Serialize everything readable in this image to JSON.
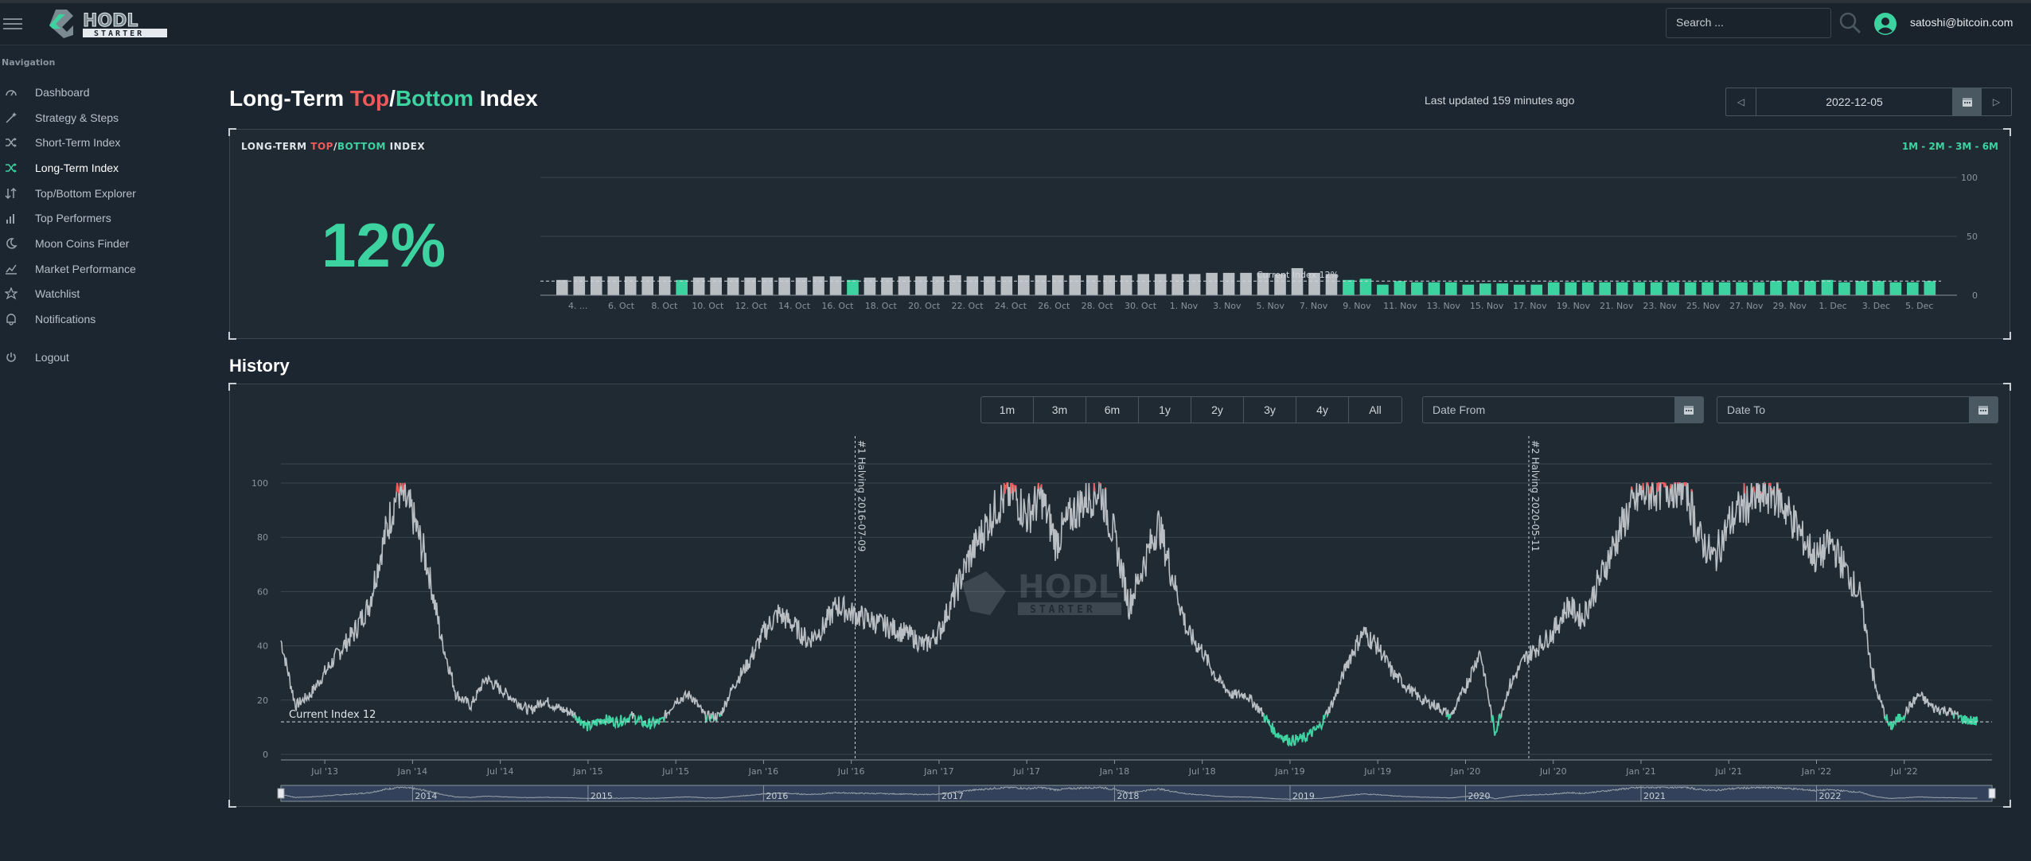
{
  "header": {
    "search_placeholder": "Search ...",
    "user_email": "satoshi@bitcoin.com"
  },
  "sidebar": {
    "title": "Navigation",
    "items": [
      {
        "label": "Dashboard",
        "icon": "gauge-icon"
      },
      {
        "label": "Strategy & Steps",
        "icon": "wand-icon"
      },
      {
        "label": "Short-Term Index",
        "icon": "shuffle-icon"
      },
      {
        "label": "Long-Term Index",
        "icon": "shuffle-icon",
        "active": true
      },
      {
        "label": "Top/Bottom Explorer",
        "icon": "sort-arrows-icon"
      },
      {
        "label": "Top Performers",
        "icon": "bar-chart-icon"
      },
      {
        "label": "Moon Coins Finder",
        "icon": "moon-icon"
      },
      {
        "label": "Market Performance",
        "icon": "line-chart-icon"
      },
      {
        "label": "Watchlist",
        "icon": "star-icon"
      },
      {
        "label": "Notifications",
        "icon": "bell-icon"
      }
    ],
    "logout": "Logout"
  },
  "page": {
    "title_prefix": "Long-Term ",
    "title_top": "Top",
    "title_slash": "/",
    "title_bottom": "Bottom",
    "title_suffix": " Index",
    "last_updated": "Last updated 159 minutes ago",
    "date_value": "2022-12-05"
  },
  "index_panel": {
    "label_prefix": "LONG-TERM ",
    "label_top": "TOP",
    "label_slash": "/",
    "label_bottom": "BOTTOM",
    "label_suffix": " INDEX",
    "ranges": "1M - 2M - 3M - 6M",
    "current_value": "12%"
  },
  "history": {
    "title": "History",
    "range_buttons": [
      "1m",
      "3m",
      "6m",
      "1y",
      "2y",
      "3y",
      "4y",
      "All"
    ],
    "date_from": "Date From",
    "date_to": "Date To"
  },
  "colors": {
    "green": "#3dd3a0",
    "red": "#ee5a5a",
    "gray_bar": "#b9bec3"
  },
  "chart_data": [
    {
      "type": "bar",
      "categories": [
        "4. ...",
        "6. Oct",
        "8. Oct",
        "10. Oct",
        "12. Oct",
        "14. Oct",
        "16. Oct",
        "18. Oct",
        "20. Oct",
        "22. Oct",
        "24. Oct",
        "26. Oct",
        "28. Oct",
        "30. Oct",
        "1. Nov",
        "3. Nov",
        "5. Nov",
        "7. Nov",
        "9. Nov",
        "11. Nov",
        "13. Nov",
        "15. Nov",
        "17. Nov",
        "19. Nov",
        "21. Nov",
        "23. Nov",
        "25. Nov",
        "27. Nov",
        "29. Nov",
        "1. Dec",
        "3. Dec",
        "5. Dec"
      ],
      "values": [
        13,
        16,
        16,
        16,
        16,
        16,
        16,
        13,
        15,
        15,
        15,
        15,
        15,
        15,
        15,
        16,
        16,
        13,
        15,
        15,
        16,
        16,
        16,
        17,
        16,
        16,
        16,
        17,
        17,
        17,
        17,
        17,
        17,
        17,
        18,
        18,
        18,
        18,
        19,
        19,
        19,
        19,
        18,
        23,
        19,
        18,
        13,
        14,
        9,
        12,
        11,
        11,
        11,
        9,
        10,
        10,
        9,
        9,
        11,
        11,
        11,
        11,
        11,
        11,
        11,
        11,
        11,
        11,
        11,
        11,
        11,
        12,
        12,
        12,
        13,
        11,
        12,
        12,
        11,
        11,
        12
      ],
      "bar_colors": [
        "gray",
        "gray",
        "gray",
        "gray",
        "gray",
        "gray",
        "gray",
        "green",
        "gray",
        "gray",
        "gray",
        "gray",
        "gray",
        "gray",
        "gray",
        "gray",
        "gray",
        "green",
        "gray",
        "gray",
        "gray",
        "gray",
        "gray",
        "gray",
        "gray",
        "gray",
        "gray",
        "gray",
        "gray",
        "gray",
        "gray",
        "gray",
        "gray",
        "gray",
        "gray",
        "gray",
        "gray",
        "gray",
        "gray",
        "gray",
        "gray",
        "gray",
        "gray",
        "gray",
        "gray",
        "gray",
        "green",
        "green",
        "green",
        "green",
        "green",
        "green",
        "green",
        "green",
        "green",
        "green",
        "green",
        "green",
        "green",
        "green",
        "green",
        "green",
        "green",
        "green",
        "green",
        "green",
        "green",
        "green",
        "green",
        "green",
        "green",
        "green",
        "green",
        "green",
        "green",
        "green",
        "green",
        "green",
        "green",
        "green",
        "green"
      ],
      "yticks": [
        0,
        50,
        100
      ],
      "ylim": [
        0,
        100
      ],
      "annotation": "Current Index 12%",
      "reference_value": 12
    },
    {
      "type": "line",
      "xticks": [
        "Jul '13",
        "Jan '14",
        "Jul '14",
        "Jan '15",
        "Jul '15",
        "Jan '16",
        "Jul '16",
        "Jan '17",
        "Jul '17",
        "Jan '18",
        "Jul '18",
        "Jan '19",
        "Jul '19",
        "Jan '20",
        "Jul '20",
        "Jan '21",
        "Jul '21",
        "Jan '22",
        "Jul '22"
      ],
      "yticks": [
        0,
        20,
        40,
        60,
        80,
        100
      ],
      "ylim": [
        0,
        100
      ],
      "x_range": [
        "2013-04",
        "2022-12"
      ],
      "points": [
        [
          "2013-04",
          42
        ],
        [
          "2013-05",
          18
        ],
        [
          "2013-06",
          22
        ],
        [
          "2013-07",
          30
        ],
        [
          "2013-08",
          38
        ],
        [
          "2013-09",
          45
        ],
        [
          "2013-10",
          55
        ],
        [
          "2013-11",
          78
        ],
        [
          "2013-12",
          98
        ],
        [
          "2014-01",
          88
        ],
        [
          "2014-02",
          70
        ],
        [
          "2014-03",
          42
        ],
        [
          "2014-04",
          22
        ],
        [
          "2014-05",
          18
        ],
        [
          "2014-06",
          28
        ],
        [
          "2014-07",
          24
        ],
        [
          "2014-08",
          20
        ],
        [
          "2014-09",
          16
        ],
        [
          "2014-10",
          20
        ],
        [
          "2014-11",
          17
        ],
        [
          "2014-12",
          15
        ],
        [
          "2015-01",
          10
        ],
        [
          "2015-02",
          13
        ],
        [
          "2015-03",
          12
        ],
        [
          "2015-04",
          14
        ],
        [
          "2015-05",
          11
        ],
        [
          "2015-06",
          12
        ],
        [
          "2015-07",
          20
        ],
        [
          "2015-08",
          22
        ],
        [
          "2015-09",
          14
        ],
        [
          "2015-10",
          14
        ],
        [
          "2015-11",
          26
        ],
        [
          "2015-12",
          34
        ],
        [
          "2016-01",
          45
        ],
        [
          "2016-02",
          52
        ],
        [
          "2016-03",
          48
        ],
        [
          "2016-04",
          42
        ],
        [
          "2016-05",
          46
        ],
        [
          "2016-06",
          55
        ],
        [
          "2016-07",
          52
        ],
        [
          "2016-08",
          50
        ],
        [
          "2016-09",
          48
        ],
        [
          "2016-10",
          46
        ],
        [
          "2016-11",
          44
        ],
        [
          "2016-12",
          40
        ],
        [
          "2017-01",
          45
        ],
        [
          "2017-02",
          58
        ],
        [
          "2017-03",
          72
        ],
        [
          "2017-04",
          82
        ],
        [
          "2017-05",
          92
        ],
        [
          "2017-06",
          97
        ],
        [
          "2017-07",
          88
        ],
        [
          "2017-08",
          95
        ],
        [
          "2017-09",
          78
        ],
        [
          "2017-10",
          88
        ],
        [
          "2017-11",
          94
        ],
        [
          "2017-12",
          98
        ],
        [
          "2018-01",
          80
        ],
        [
          "2018-02",
          55
        ],
        [
          "2018-03",
          70
        ],
        [
          "2018-04",
          85
        ],
        [
          "2018-05",
          65
        ],
        [
          "2018-06",
          45
        ],
        [
          "2018-07",
          38
        ],
        [
          "2018-08",
          28
        ],
        [
          "2018-09",
          22
        ],
        [
          "2018-10",
          22
        ],
        [
          "2018-11",
          16
        ],
        [
          "2018-12",
          8
        ],
        [
          "2019-01",
          5
        ],
        [
          "2019-02",
          6
        ],
        [
          "2019-03",
          10
        ],
        [
          "2019-04",
          20
        ],
        [
          "2019-05",
          35
        ],
        [
          "2019-06",
          45
        ],
        [
          "2019-07",
          40
        ],
        [
          "2019-08",
          30
        ],
        [
          "2019-09",
          25
        ],
        [
          "2019-10",
          20
        ],
        [
          "2019-11",
          18
        ],
        [
          "2019-12",
          14
        ],
        [
          "2020-01",
          25
        ],
        [
          "2020-02",
          38
        ],
        [
          "2020-03",
          8
        ],
        [
          "2020-04",
          25
        ],
        [
          "2020-05",
          35
        ],
        [
          "2020-06",
          40
        ],
        [
          "2020-07",
          45
        ],
        [
          "2020-08",
          55
        ],
        [
          "2020-09",
          50
        ],
        [
          "2020-10",
          62
        ],
        [
          "2020-11",
          75
        ],
        [
          "2020-12",
          88
        ],
        [
          "2021-01",
          96
        ],
        [
          "2021-02",
          98
        ],
        [
          "2021-03",
          99
        ],
        [
          "2021-04",
          100
        ],
        [
          "2021-05",
          80
        ],
        [
          "2021-06",
          72
        ],
        [
          "2021-07",
          85
        ],
        [
          "2021-08",
          92
        ],
        [
          "2021-09",
          94
        ],
        [
          "2021-10",
          97
        ],
        [
          "2021-11",
          90
        ],
        [
          "2021-12",
          80
        ],
        [
          "2022-01",
          72
        ],
        [
          "2022-02",
          78
        ],
        [
          "2022-03",
          68
        ],
        [
          "2022-04",
          58
        ],
        [
          "2022-05",
          25
        ],
        [
          "2022-06",
          10
        ],
        [
          "2022-07",
          15
        ],
        [
          "2022-08",
          22
        ],
        [
          "2022-09",
          17
        ],
        [
          "2022-10",
          16
        ],
        [
          "2022-11",
          13
        ],
        [
          "2022-12",
          12
        ]
      ],
      "annotations": [
        {
          "date": "2016-07-09",
          "text": "#1 Halving 2016-07-09"
        },
        {
          "date": "2020-05-11",
          "text": "#2 Halving 2020-05-11"
        }
      ],
      "reference_label": "Current Index 12",
      "reference_value": 12,
      "navigator_years": [
        "2014",
        "2015",
        "2016",
        "2017",
        "2018",
        "2019",
        "2020",
        "2021",
        "2022"
      ],
      "colors": {
        "line": "#b9bec3",
        "bottom_zone": "#3dd3a0",
        "top_zone": "#ee5a5a"
      }
    }
  ]
}
